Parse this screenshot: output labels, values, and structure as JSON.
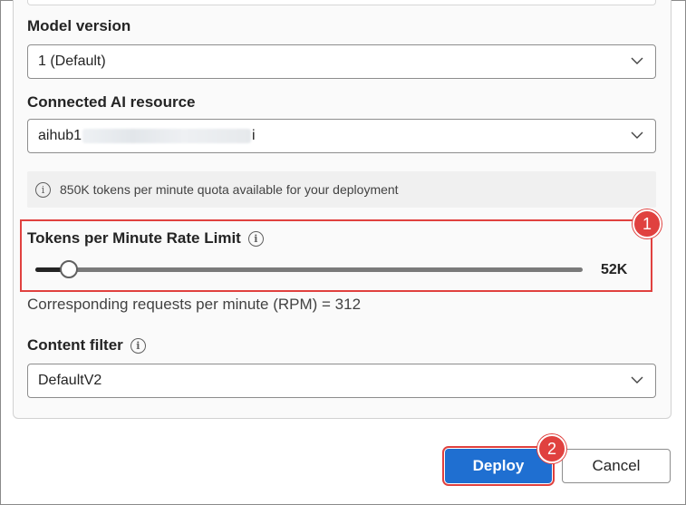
{
  "form": {
    "model_version": {
      "label": "Model version",
      "value": "1 (Default)"
    },
    "connected_resource": {
      "label": "Connected AI resource",
      "value_prefix": "aihub1",
      "value_suffix": "i"
    },
    "quota_info": "850K tokens per minute quota available for your deployment",
    "rate_limit": {
      "label": "Tokens per Minute Rate Limit",
      "value_text": "52K",
      "fraction": 0.061
    },
    "rpm_text": "Corresponding requests per minute (RPM) = 312",
    "content_filter": {
      "label": "Content filter",
      "value": "DefaultV2"
    }
  },
  "actions": {
    "deploy_label": "Deploy",
    "cancel_label": "Cancel"
  },
  "annotations": {
    "badge_1": "1",
    "badge_2": "2"
  },
  "icons": {
    "info": "info-icon",
    "chevron": "chevron-down-icon"
  },
  "colors": {
    "accent": "#1f6fd1",
    "highlight": "#e0413f"
  }
}
